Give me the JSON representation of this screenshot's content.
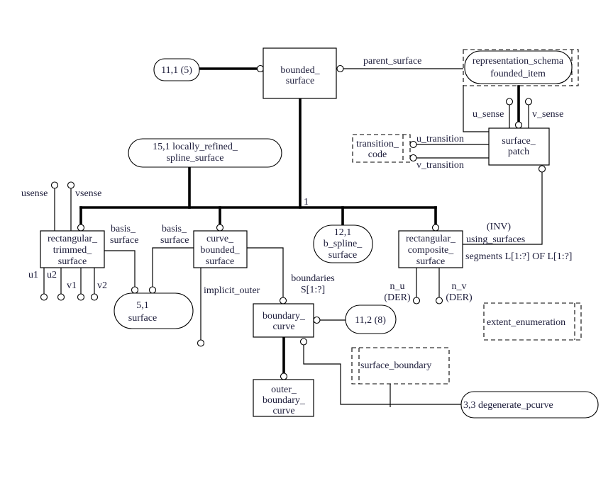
{
  "diagram": {
    "type": "EXPRESS-G schema diagram",
    "entities": {
      "bounded_surface": {
        "lines": [
          "bounded_",
          "surface"
        ]
      },
      "surface_patch": {
        "lines": [
          "surface_",
          "patch"
        ]
      },
      "rectangular_trimmed_surface": {
        "lines": [
          "rectangular_",
          "trimmed_",
          "surface"
        ]
      },
      "curve_bounded_surface": {
        "lines": [
          "curve_",
          "bounded_",
          "surface"
        ]
      },
      "rectangular_composite_surface": {
        "lines": [
          "rectangular_",
          "composite_",
          "surface"
        ]
      },
      "boundary_curve": {
        "lines": [
          "boundary_",
          "curve"
        ]
      },
      "outer_boundary_curve": {
        "lines": [
          "outer_",
          "boundary_",
          "curve"
        ]
      }
    },
    "page_references": {
      "ref_11_1": {
        "lines": [
          "11,1 (5)"
        ]
      },
      "founded_item": {
        "lines": [
          "representation_schema",
          "founded_item"
        ]
      },
      "locally_refined": {
        "lines": [
          "15,1 locally_refined_",
          "spline_surface"
        ]
      },
      "b_spline_surface": {
        "lines": [
          "12,1",
          "b_spline_",
          "surface"
        ]
      },
      "surface": {
        "lines": [
          "5,1",
          "surface"
        ]
      },
      "ref_11_2": {
        "lines": [
          "11,2 (8)"
        ]
      },
      "degenerate_pcurve": {
        "lines": [
          "3,3 degenerate_pcurve"
        ]
      }
    },
    "types": {
      "transition_code": {
        "lines": [
          "transition_",
          "code"
        ]
      },
      "extent_enumeration": {
        "lines": [
          "extent_enumeration"
        ]
      },
      "surface_boundary": {
        "lines": [
          "surface_boundary"
        ]
      }
    },
    "attributes": {
      "parent_surface": "parent_surface",
      "u_sense": "u_sense",
      "v_sense": "v_sense",
      "u_transition": "u_transition",
      "v_transition": "v_transition",
      "usense": "usense",
      "vsense": "vsense",
      "basis_surface_left": [
        "basis_",
        "surface"
      ],
      "basis_surface_right": [
        "basis_",
        "surface"
      ],
      "u1": "u1",
      "u2": "u2",
      "v1": "v1",
      "v2": "v2",
      "implicit_outer": "implicit_outer",
      "boundaries": [
        "boundaries",
        "S[1:?]"
      ],
      "using_surfaces": [
        "(INV)",
        "using_surfaces"
      ],
      "segments": "segments L[1:?]  OF L[1:?]",
      "n_u": [
        "n_u",
        "(DER)"
      ],
      "n_v": [
        "n_v",
        "(DER)"
      ],
      "supertype_cardinality": "1"
    }
  }
}
